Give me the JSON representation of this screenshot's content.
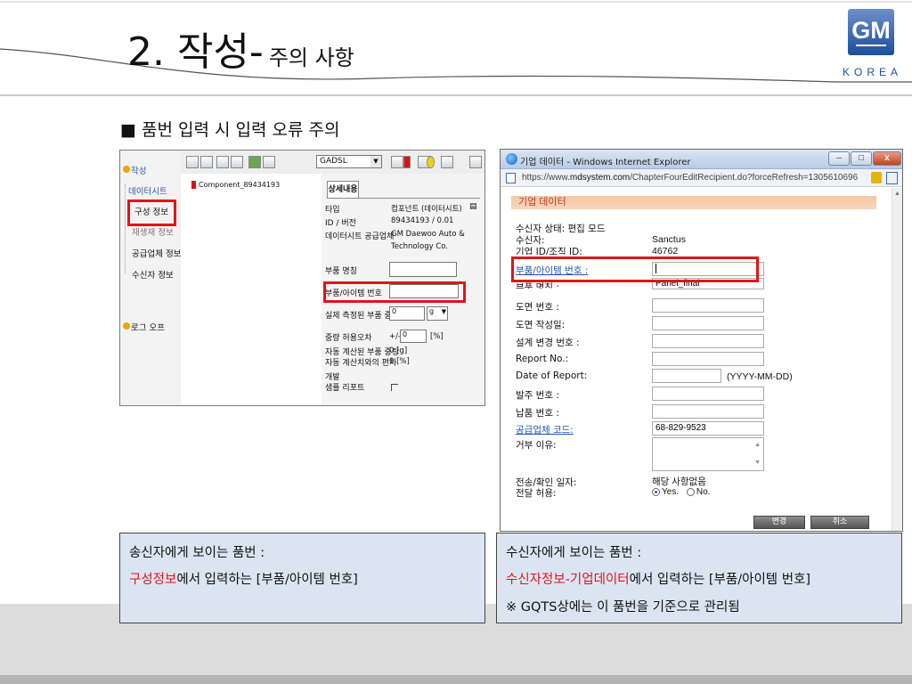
{
  "header": {
    "title_main": "2. 작성-",
    "title_sub": "주의 사항",
    "logo_gm": "GM",
    "logo_korea": "KOREA"
  },
  "heading": "■ 품번 입력 시 입력 오류 주의",
  "left_app": {
    "nav": {
      "item_create": "작성",
      "item_datasheet": "데이터시트",
      "item_config": "구성 정보",
      "item_material": "재생재 정보",
      "item_supplier": "공급업체 정보",
      "item_recipient": "수신자 정보",
      "item_logout": "로그 오프"
    },
    "toolbar": {
      "combo_value": "GADSL"
    },
    "tree": {
      "component_node": "Component_89434193"
    },
    "detail": {
      "tab": "상세내용",
      "rows": {
        "type_label": "타입",
        "type_value": "컴포넌트 (데이터시트)",
        "id_label": "ID / 버전",
        "id_value": "89434193 / 0.01",
        "supplier_label": "데이터시트 공급업체",
        "supplier_value_1": "GM Daewoo Auto &",
        "supplier_value_2": "Technology Co.",
        "partname_label": "부품 명칭",
        "partno_label": "부품/아이템 번호",
        "measured_label": "실제 측정된 부품 중량",
        "measured_value": "0",
        "unit_value": "g",
        "tolerance_label": "중량 허용오차",
        "tolerance_prefix": "+/-",
        "tolerance_value": "0",
        "tolerance_unit": "[%]",
        "calc_label": "자동 계산된 부품 중량",
        "calc_value": "0 [g]",
        "dev_label": "자동 계산치와의 편차",
        "dev_value": "0 [%]",
        "develop_label": "개발",
        "sample_label": "샘플 리포트"
      }
    }
  },
  "right_app": {
    "window_title": "기업 데이터 - Windows Internet Explorer",
    "url_prefix": "https://www.",
    "url_domain": "mdsystem.com",
    "url_rest": "/ChapterFourEditRecipient.do?forceRefresh=1305610696",
    "section_title": "기업 데이터",
    "status_label": "수신자 상태: 편집 모드",
    "recipient_label": "수신자:",
    "recipient_value": "Sanctus",
    "orgid_label": "기업 ID/조직 ID:",
    "orgid_value": "46762",
    "partno_label": "부품/아이템 번호 :",
    "partname_label": "부품 명칭 :",
    "partname_value": "Panel_final",
    "drawing_label": "도면 번호 :",
    "drawdate_label": "도면 작성일:",
    "change_label": "설계 변경 번호 :",
    "report_label": "Report No.:",
    "reportdate_label": "Date of Report:",
    "date_format": "(YYYY-MM-DD)",
    "order_label": "발주 번호 :",
    "delivery_label": "납품 번호 :",
    "suppcode_label": "공급업체 코드:",
    "suppcode_value": "68-829-9523",
    "reject_label": "거부 이유:",
    "sent_label": "전송/확인 일자:",
    "sent_value": "해당 사항없음",
    "forward_label": "전달 허용:",
    "opt_yes": "Yes.",
    "opt_no": "No.",
    "btn_change": "변경",
    "btn_cancel": "취소"
  },
  "captions": {
    "left_line1": "송신자에게 보이는 품번 :",
    "left_red": "구성정보",
    "left_line2_rest": "에서 입력하는 [부품/아이템 번호]",
    "right_line1": "수신자에게 보이는 품번 :",
    "right_red": "수신자정보-기업데이터",
    "right_line2_rest": "에서 입력하는 [부품/아이템 번호]",
    "right_line3": "※ GQTS상에는 이 품번을 기준으로 관리됨"
  },
  "colors": {
    "highlight": "#e0141b",
    "caption_bg": "#dbe5f1",
    "gm_blue": "#1b4f9c"
  }
}
